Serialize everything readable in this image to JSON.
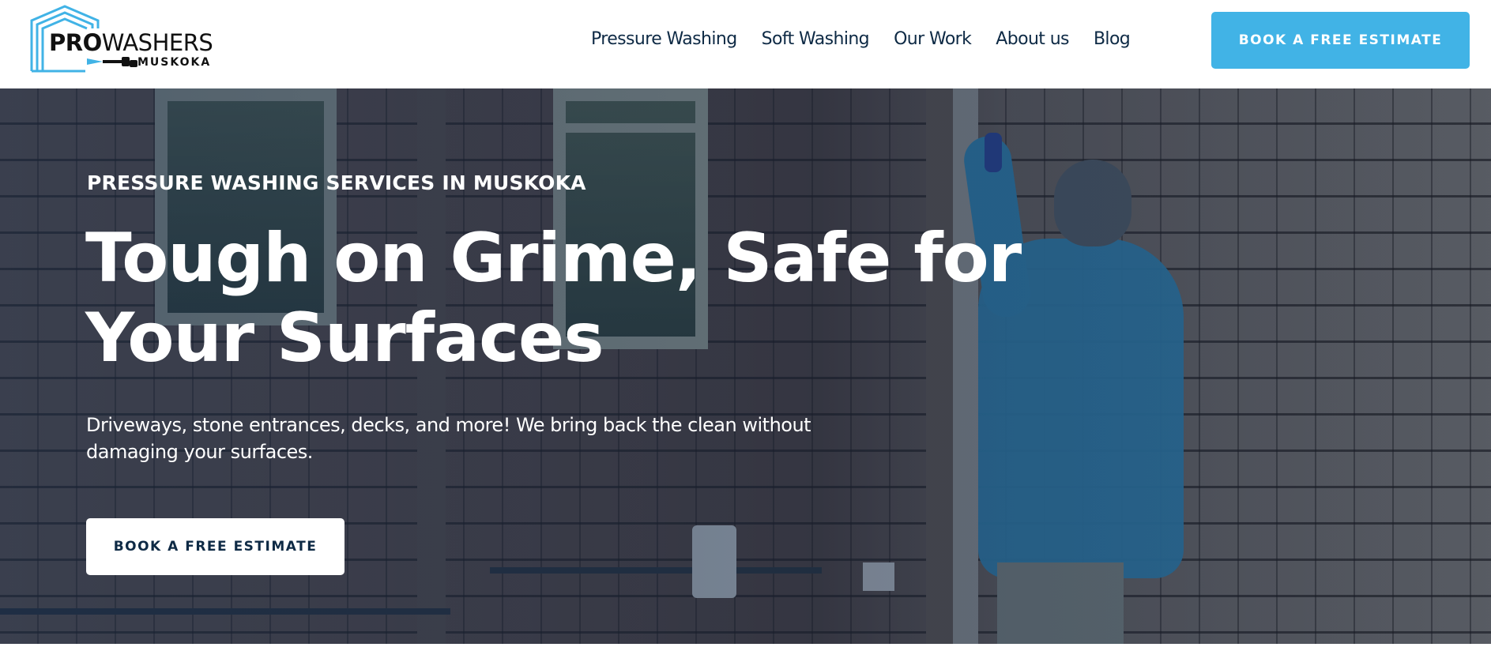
{
  "brand": {
    "logo_pro": "PRO",
    "logo_washers": "WASHERS",
    "logo_location": "MUSKOKA",
    "colors": {
      "accent": "#41b3e6",
      "navy": "#0e2a45",
      "hero_overlay": "#1c304e"
    }
  },
  "nav": {
    "items": [
      {
        "label": "Pressure Washing"
      },
      {
        "label": "Soft Washing"
      },
      {
        "label": "Our Work"
      },
      {
        "label": "About us"
      },
      {
        "label": "Blog"
      }
    ],
    "cta_label": "BOOK A FREE ESTIMATE"
  },
  "hero": {
    "eyebrow": "PRESSURE WASHING SERVICES IN MUSKOKA",
    "title_line1": "Tough on Grime, Safe for",
    "title_line2": "Your Surfaces",
    "subtitle": "Driveways, stone entrances, decks, and more! We bring back the clean without damaging your surfaces.",
    "cta_label": "BOOK A FREE ESTIMATE",
    "image_description_icon": "hero-photo"
  }
}
